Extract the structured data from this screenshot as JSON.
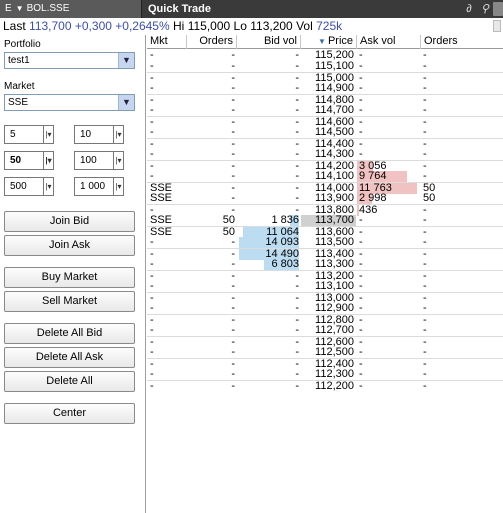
{
  "titlebar": {
    "instrument_prefix": "E",
    "instrument": "BOL.SSE",
    "title": "Quick Trade"
  },
  "summary": {
    "last_label": "Last",
    "last_value": "113,700",
    "change": "+0,300",
    "change_pct": "+0,2645%",
    "hi_label": "Hi",
    "hi_value": "115,000",
    "lo_label": "Lo",
    "lo_value": "113,200",
    "vol_label": "Vol",
    "vol_value": "725k"
  },
  "left": {
    "portfolio_label": "Portfolio",
    "portfolio_value": "test1",
    "market_label": "Market",
    "market_value": "SSE",
    "quantities": [
      "5",
      "10",
      "50",
      "100",
      "500",
      "1 000"
    ],
    "buttons": {
      "join_bid": "Join Bid",
      "join_ask": "Join Ask",
      "buy_market": "Buy Market",
      "sell_market": "Sell Market",
      "delete_all_bid": "Delete All Bid",
      "delete_all_ask": "Delete All Ask",
      "delete_all": "Delete All",
      "center": "Center"
    }
  },
  "ladder": {
    "headers": {
      "mkt": "Mkt",
      "orders": "Orders",
      "bid_vol": "Bid vol",
      "price": "Price",
      "ask_vol": "Ask vol",
      "ask_orders": "Orders"
    },
    "max_volume": 11763,
    "last_price": "113,700",
    "rows": [
      {
        "mkt": "-",
        "orders": "-",
        "bid_vol": "-",
        "price": "115,200",
        "ask_vol": "-",
        "ask_orders": "-"
      },
      {
        "mkt": "-",
        "orders": "-",
        "bid_vol": "-",
        "price": "115,100",
        "ask_vol": "-",
        "ask_orders": "-"
      },
      {
        "mkt": "-",
        "orders": "-",
        "bid_vol": "-",
        "price": "115,000",
        "ask_vol": "-",
        "ask_orders": "-"
      },
      {
        "mkt": "-",
        "orders": "-",
        "bid_vol": "-",
        "price": "114,900",
        "ask_vol": "-",
        "ask_orders": "-"
      },
      {
        "mkt": "-",
        "orders": "-",
        "bid_vol": "-",
        "price": "114,800",
        "ask_vol": "-",
        "ask_orders": "-"
      },
      {
        "mkt": "-",
        "orders": "-",
        "bid_vol": "-",
        "price": "114,700",
        "ask_vol": "-",
        "ask_orders": "-"
      },
      {
        "mkt": "-",
        "orders": "-",
        "bid_vol": "-",
        "price": "114,600",
        "ask_vol": "-",
        "ask_orders": "-"
      },
      {
        "mkt": "-",
        "orders": "-",
        "bid_vol": "-",
        "price": "114,500",
        "ask_vol": "-",
        "ask_orders": "-"
      },
      {
        "mkt": "-",
        "orders": "-",
        "bid_vol": "-",
        "price": "114,400",
        "ask_vol": "-",
        "ask_orders": "-"
      },
      {
        "mkt": "-",
        "orders": "-",
        "bid_vol": "-",
        "price": "114,300",
        "ask_vol": "-",
        "ask_orders": "-"
      },
      {
        "mkt": "-",
        "orders": "-",
        "bid_vol": "-",
        "price": "114,200",
        "ask_vol": "3 056",
        "ask_orders": "-",
        "ask_num": 3056
      },
      {
        "mkt": "-",
        "orders": "-",
        "bid_vol": "-",
        "price": "114,100",
        "ask_vol": "9 764",
        "ask_orders": "-",
        "ask_num": 9764
      },
      {
        "mkt": "SSE",
        "orders": "-",
        "bid_vol": "-",
        "price": "114,000",
        "ask_vol": "11 763",
        "ask_orders": "50",
        "ask_num": 11763
      },
      {
        "mkt": "SSE",
        "orders": "-",
        "bid_vol": "-",
        "price": "113,900",
        "ask_vol": "2 998",
        "ask_orders": "50",
        "ask_num": 2998
      },
      {
        "mkt": "-",
        "orders": "-",
        "bid_vol": "-",
        "price": "113,800",
        "ask_vol": "436",
        "ask_orders": "-",
        "ask_num": 436
      },
      {
        "mkt": "SSE",
        "orders": "50",
        "bid_vol": "1 836",
        "price": "113,700",
        "ask_vol": "-",
        "ask_orders": "-",
        "bid_num": 1836
      },
      {
        "mkt": "SSE",
        "orders": "50",
        "bid_vol": "11 064",
        "price": "113,600",
        "ask_vol": "-",
        "ask_orders": "-",
        "bid_num": 11064
      },
      {
        "mkt": "-",
        "orders": "-",
        "bid_vol": "14 093",
        "price": "113,500",
        "ask_vol": "-",
        "ask_orders": "-",
        "bid_num": 14093
      },
      {
        "mkt": "-",
        "orders": "-",
        "bid_vol": "14 490",
        "price": "113,400",
        "ask_vol": "-",
        "ask_orders": "-",
        "bid_num": 14490
      },
      {
        "mkt": "-",
        "orders": "-",
        "bid_vol": "6 803",
        "price": "113,300",
        "ask_vol": "-",
        "ask_orders": "-",
        "bid_num": 6803
      },
      {
        "mkt": "-",
        "orders": "-",
        "bid_vol": "-",
        "price": "113,200",
        "ask_vol": "-",
        "ask_orders": "-"
      },
      {
        "mkt": "-",
        "orders": "-",
        "bid_vol": "-",
        "price": "113,100",
        "ask_vol": "-",
        "ask_orders": "-"
      },
      {
        "mkt": "-",
        "orders": "-",
        "bid_vol": "-",
        "price": "113,000",
        "ask_vol": "-",
        "ask_orders": "-"
      },
      {
        "mkt": "-",
        "orders": "-",
        "bid_vol": "-",
        "price": "112,900",
        "ask_vol": "-",
        "ask_orders": "-"
      },
      {
        "mkt": "-",
        "orders": "-",
        "bid_vol": "-",
        "price": "112,800",
        "ask_vol": "-",
        "ask_orders": "-"
      },
      {
        "mkt": "-",
        "orders": "-",
        "bid_vol": "-",
        "price": "112,700",
        "ask_vol": "-",
        "ask_orders": "-"
      },
      {
        "mkt": "-",
        "orders": "-",
        "bid_vol": "-",
        "price": "112,600",
        "ask_vol": "-",
        "ask_orders": "-"
      },
      {
        "mkt": "-",
        "orders": "-",
        "bid_vol": "-",
        "price": "112,500",
        "ask_vol": "-",
        "ask_orders": "-"
      },
      {
        "mkt": "-",
        "orders": "-",
        "bid_vol": "-",
        "price": "112,400",
        "ask_vol": "-",
        "ask_orders": "-"
      },
      {
        "mkt": "-",
        "orders": "-",
        "bid_vol": "-",
        "price": "112,300",
        "ask_vol": "-",
        "ask_orders": "-"
      },
      {
        "mkt": "-",
        "orders": "-",
        "bid_vol": "-",
        "price": "112,200",
        "ask_vol": "-",
        "ask_orders": "-"
      }
    ]
  },
  "colors": {
    "bid_bar": "#bcdcf2",
    "ask_bar": "#f0c2c2",
    "last_price_highlight": "#d0d0d0",
    "summary_value": "#3b4fb0"
  },
  "icons": [
    "caret-down-icon",
    "link-icon",
    "pin-icon",
    "scroll-arrow-icon"
  ]
}
